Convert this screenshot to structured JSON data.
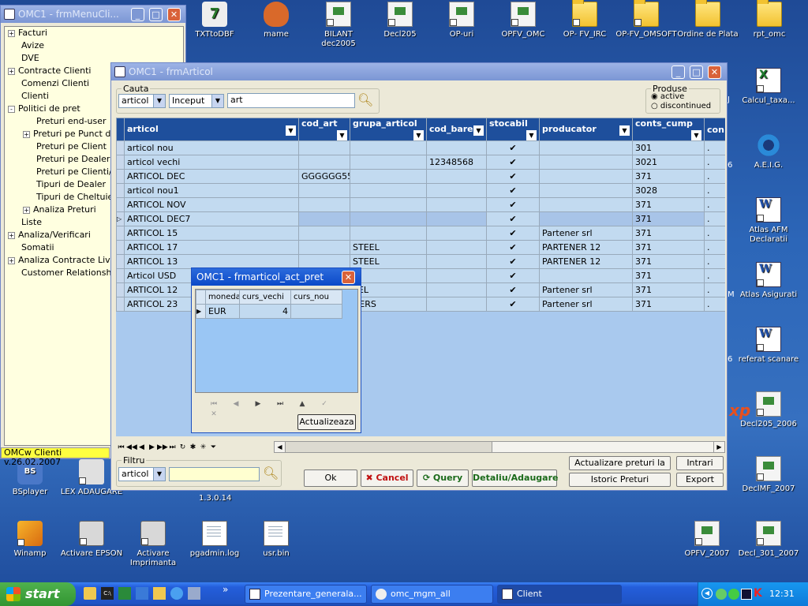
{
  "desktop": {
    "top_icons": [
      "TXTtoDBF",
      "mame",
      "BILANT dec2005",
      "Decl205",
      "OP-uri",
      "OPFV_OMC",
      "OP- FV_IRC",
      "OP-FV_OMSOFT",
      "Ordine de Plata",
      "rpt_omc"
    ],
    "right_icons": [
      "Calcul_taxa...",
      "A.E.I.G.",
      "Atlas AFM Declaratii",
      "Atlas Asigurati",
      "referat scanare",
      "Decl205_2006",
      "DeclMF_2007",
      "OPFV_2007",
      "Decl_301_2007"
    ],
    "partial_right": [
      "J",
      "6",
      "M",
      "6"
    ],
    "bottom_icons": [
      "BSplayer",
      "LEX ADAUGARE",
      "Winamp",
      "Activare EPSON",
      "Activare Imprimanta",
      "pgadmin.log",
      "usr.bin"
    ],
    "partial_bottom": "1.3.0.14",
    "xp_text": "xp"
  },
  "menu_window": {
    "title": "OMC1 - frmMenuCli...",
    "items": [
      {
        "label": "Facturi",
        "exp": "+"
      },
      {
        "label": "Avize",
        "exp": ""
      },
      {
        "label": "DVE",
        "exp": ""
      },
      {
        "label": "Contracte Clienti",
        "exp": "+"
      },
      {
        "label": "Comenzi Clienti",
        "exp": ""
      },
      {
        "label": "Clienti",
        "exp": ""
      },
      {
        "label": "Politici de pret",
        "exp": "-"
      },
      {
        "label": "Preturi end-user",
        "exp": ""
      },
      {
        "label": "Preturi pe Punct de",
        "exp": "+"
      },
      {
        "label": "Preturi pe Client",
        "exp": ""
      },
      {
        "label": "Preturi pe Dealer",
        "exp": ""
      },
      {
        "label": "Preturi pe Clienti/Gru",
        "exp": ""
      },
      {
        "label": "Tipuri de Dealer",
        "exp": ""
      },
      {
        "label": "Tipuri de Cheltuieli ir",
        "exp": ""
      },
      {
        "label": "Analiza Preturi",
        "exp": "+"
      },
      {
        "label": "Liste",
        "exp": ""
      },
      {
        "label": "Analiza/Verificari",
        "exp": "+"
      },
      {
        "label": "Somatii",
        "exp": ""
      },
      {
        "label": "Analiza Contracte Livrari",
        "exp": "+"
      },
      {
        "label": "Customer Relationship",
        "exp": ""
      }
    ],
    "status": "OMCw Clienti v.26.02.2007"
  },
  "articol_window": {
    "title": "OMC1 - frmArticol",
    "cauta_label": "Cauta",
    "cauta_field": "articol",
    "cauta_mode": "Inceput",
    "cauta_value": "art",
    "produse_label": "Produse",
    "produse_active": "active",
    "produse_discontinued": "discontinued",
    "columns": [
      "articol",
      "cod_art",
      "grupa_articol",
      "cod_bare",
      "stocabil",
      "producator",
      "conts_cump",
      "con"
    ],
    "rows": [
      [
        "articol nou",
        "",
        "",
        "",
        "✔",
        "",
        "301",
        "."
      ],
      [
        "articol vechi",
        "",
        "",
        "12348568",
        "✔",
        "",
        "3021",
        "."
      ],
      [
        "ARTICOL DEC",
        "GGGGGG55",
        "",
        "",
        "✔",
        "",
        "371",
        "."
      ],
      [
        "articol nou1",
        "",
        "",
        "",
        "✔",
        "",
        "3028",
        "."
      ],
      [
        "ARTICOL NOV",
        "",
        "",
        "",
        "✔",
        "",
        "371",
        "."
      ],
      [
        "ARTICOL DEC7",
        "",
        "",
        "",
        "✔",
        "",
        "371",
        "."
      ],
      [
        "ARTICOL 15",
        "",
        "",
        "",
        "✔",
        "Partener srl",
        "371",
        "."
      ],
      [
        "ARTICOL 17",
        "",
        "STEEL",
        "",
        "✔",
        "PARTENER 12",
        "371",
        "."
      ],
      [
        "ARTICOL 13",
        "",
        "STEEL",
        "",
        "✔",
        "PARTENER 12",
        "371",
        "."
      ],
      [
        "Articol USD",
        "",
        "",
        "",
        "✔",
        "",
        "371",
        "."
      ],
      [
        "ARTICOL 12",
        "",
        "EEL",
        "",
        "✔",
        "Partener srl",
        "371",
        "."
      ],
      [
        "ARTICOL 23",
        "",
        "HERS",
        "",
        "✔",
        "Partener srl",
        "371",
        "."
      ]
    ],
    "filtru_label": "Filtru",
    "filtru_field": "articol",
    "buttons": {
      "ok": "Ok",
      "cancel": "Cancel",
      "query": "Query",
      "detaliu": "Detaliu/Adaugare",
      "act_preturi": "Actualizare preturi la curs",
      "istoric": "Istoric Preturi",
      "intrari": "Intrari",
      "export": "Export"
    }
  },
  "pret_dialog": {
    "title": "OMC1 - frmarticol_act_pret",
    "columns": [
      "moneda",
      "curs_vechi",
      "curs_nou"
    ],
    "row": [
      "EUR",
      "4",
      ""
    ],
    "button": "Actualizeaza"
  },
  "taskbar": {
    "start": "start",
    "tasks": [
      "Prezentare_generala...",
      "omc_mgm_all",
      "Client"
    ],
    "clock": "12:31 PM",
    "more": "»"
  }
}
